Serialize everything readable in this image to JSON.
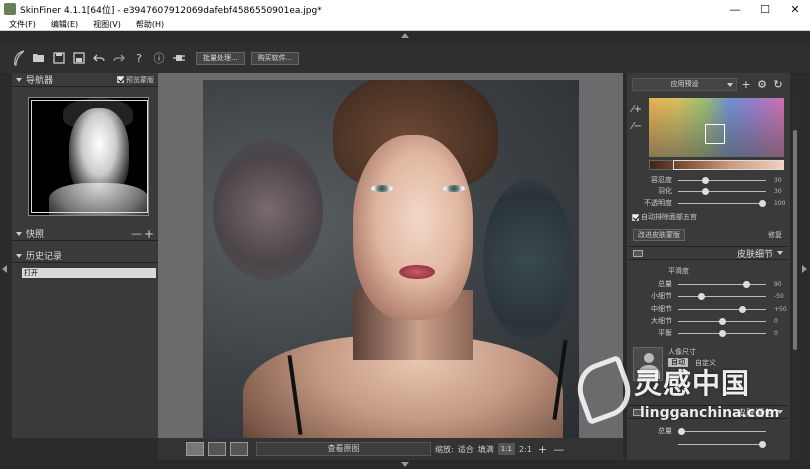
{
  "window": {
    "title": "SkinFiner 4.1.1[64位] - e3947607912069dafebf4586550901ea.jpg*",
    "minimize": "—",
    "maximize": "☐",
    "close": "✕"
  },
  "menu": [
    "文件(F)",
    "编辑(E)",
    "视图(V)",
    "帮助(H)"
  ],
  "toolbar": {
    "batch_label": "批量处理...",
    "buy_label": "购买软件..."
  },
  "left": {
    "navigator_title": "导航器",
    "preview_mask_label": "预览蒙版",
    "snapshot_title": "快照",
    "history_title": "历史记录",
    "history_items": [
      "打开"
    ]
  },
  "canvas_bottom": {
    "compare_label": "查看原图",
    "zoom_label": "缩放:",
    "fit_label": "适合",
    "fill_label": "填满",
    "ratio_1_1": "1:1",
    "ratio_2_1": "2:1",
    "plus": "+",
    "minus": "—"
  },
  "right": {
    "preset_label": "应用预设",
    "tone_sliders": [
      {
        "label": "容忍度",
        "value": "30",
        "pos": 0.3
      },
      {
        "label": "羽化",
        "value": "30",
        "pos": 0.3
      },
      {
        "label": "不透明度",
        "value": "100",
        "pos": 1.0
      }
    ],
    "auto_label": "自动排除面部五官",
    "mask_btn_label": "改进皮肤蒙版",
    "reset_label": "修复",
    "skin_detail_title": "皮肤细节",
    "smooth_subhead": "平滑度",
    "detail_sliders": [
      {
        "label": "总量",
        "value": "90",
        "pos": 0.8
      },
      {
        "label": "小细节",
        "value": "-50",
        "pos": 0.25
      },
      {
        "label": "中细节",
        "value": "+50",
        "pos": 0.75
      },
      {
        "label": "大细节",
        "value": "0",
        "pos": 0.5
      },
      {
        "label": "平衡",
        "value": "0",
        "pos": 0.5
      }
    ],
    "face_size_label": "人像尺寸",
    "face_auto_label": "自动",
    "face_custom_label": "自定义",
    "skin_tone_title": "皮肤调色",
    "bottom_sliders": [
      {
        "label": "总量",
        "value": "",
        "pos": 0.0
      },
      {
        "label": "",
        "value": "",
        "pos": 1.0
      }
    ]
  },
  "watermark": {
    "brand": "灵感中国",
    "url": "lingganchina.com"
  }
}
